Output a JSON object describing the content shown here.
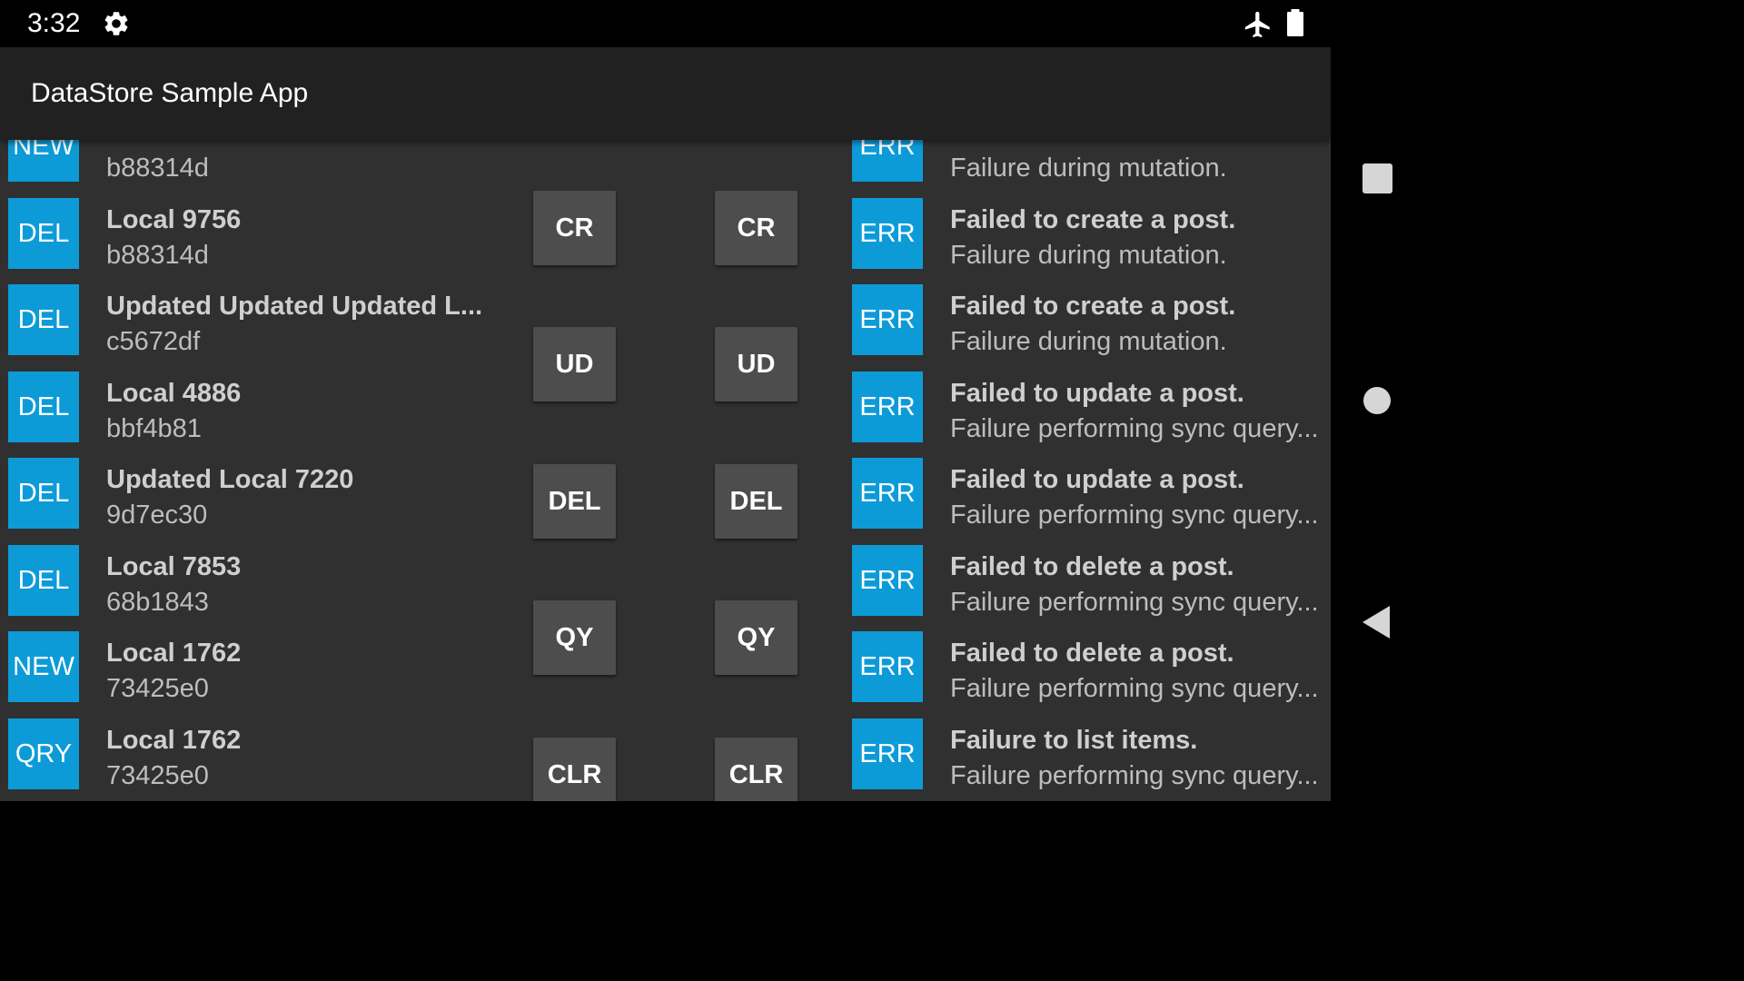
{
  "status_bar": {
    "time": "3:32",
    "icons": [
      "gear-icon",
      "airplane-mode-icon",
      "battery-icon"
    ]
  },
  "app_bar": {
    "title": "DataStore Sample App"
  },
  "local_items": [
    {
      "badge": "NEW",
      "title": "",
      "subtitle": "b88314d"
    },
    {
      "badge": "DEL",
      "title": "Local 9756",
      "subtitle": "b88314d"
    },
    {
      "badge": "DEL",
      "title": "Updated Updated Updated L...",
      "subtitle": "c5672df"
    },
    {
      "badge": "DEL",
      "title": "Local 4886",
      "subtitle": "bbf4b81"
    },
    {
      "badge": "DEL",
      "title": "Updated Local 7220",
      "subtitle": "9d7ec30"
    },
    {
      "badge": "DEL",
      "title": "Local 7853",
      "subtitle": "68b1843"
    },
    {
      "badge": "NEW",
      "title": "Local 1762",
      "subtitle": "73425e0"
    },
    {
      "badge": "QRY",
      "title": "Local 1762",
      "subtitle": "73425e0"
    }
  ],
  "buttons_left": [
    "CR",
    "UD",
    "DEL",
    "QY",
    "CLR"
  ],
  "buttons_right": [
    "CR",
    "UD",
    "DEL",
    "QY",
    "CLR"
  ],
  "remote_items": [
    {
      "badge": "ERR",
      "title": "",
      "subtitle": "Failure during mutation."
    },
    {
      "badge": "ERR",
      "title": "Failed to create a post.",
      "subtitle": "Failure during mutation."
    },
    {
      "badge": "ERR",
      "title": "Failed to create a post.",
      "subtitle": "Failure during mutation."
    },
    {
      "badge": "ERR",
      "title": "Failed to update a post.",
      "subtitle": "Failure performing sync query..."
    },
    {
      "badge": "ERR",
      "title": "Failed to update a post.",
      "subtitle": "Failure performing sync query..."
    },
    {
      "badge": "ERR",
      "title": "Failed to delete a post.",
      "subtitle": "Failure performing sync query..."
    },
    {
      "badge": "ERR",
      "title": "Failed to delete a post.",
      "subtitle": "Failure performing sync query..."
    },
    {
      "badge": "ERR",
      "title": "Failure to list items.",
      "subtitle": "Failure performing sync query..."
    }
  ],
  "colors": {
    "badge": "#0d9bd8",
    "content_bg": "#303030",
    "app_bar_bg": "#212121",
    "button_bg": "#4d4d4d"
  }
}
